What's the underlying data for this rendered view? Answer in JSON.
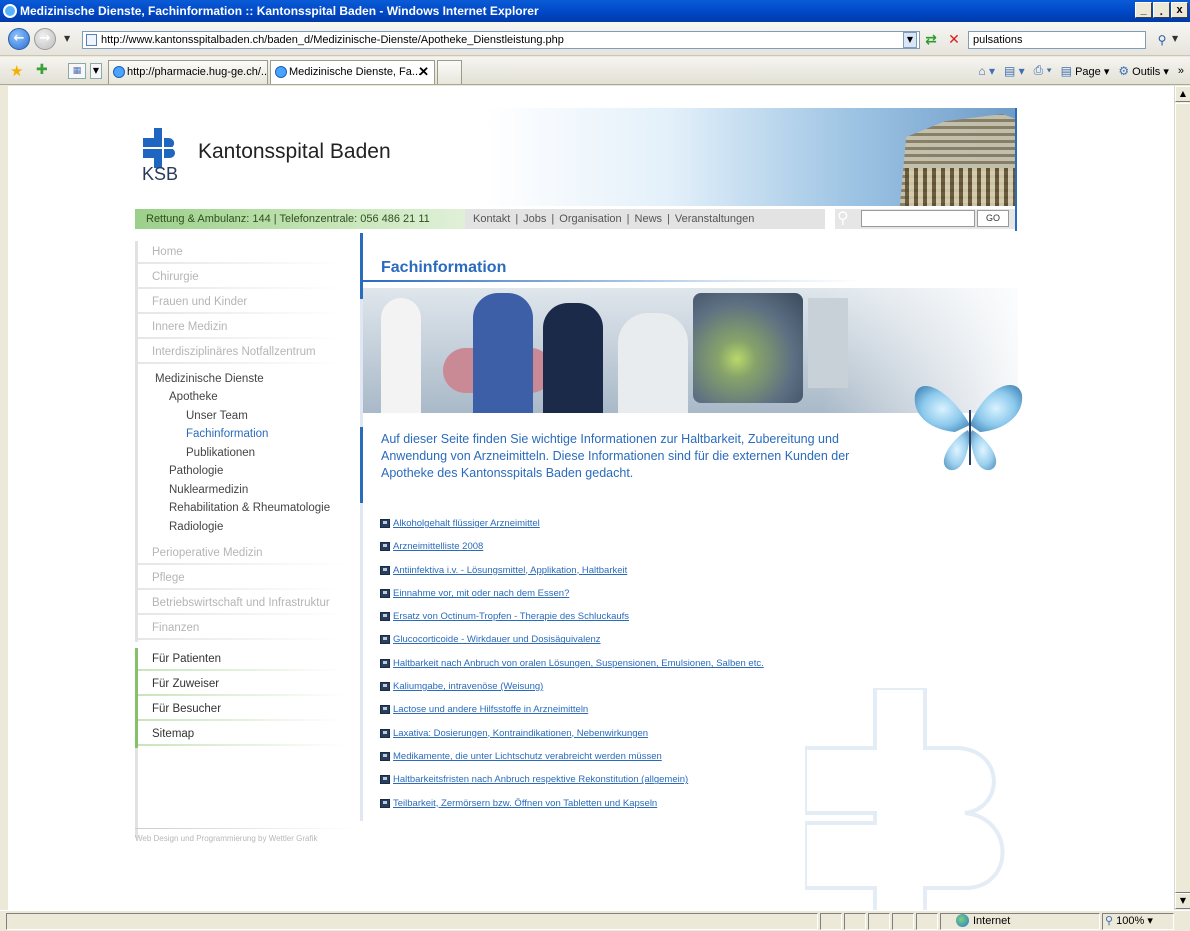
{
  "window": {
    "title": "Medizinische Dienste, Fachinformation :: Kantonsspital Baden - Windows Internet Explorer",
    "controls": [
      "_",
      "¸",
      "x"
    ]
  },
  "addressbar": {
    "url": "http://www.kantonsspitalbaden.ch/baden_d/Medizinische-Dienste/Apotheke_Dienstleistung.php",
    "search_value": "pulsations"
  },
  "tabs": [
    {
      "label": "http://pharmacie.hug-ge.ch/...",
      "active": false
    },
    {
      "label": "Medizinische Dienste, Fa...",
      "active": true
    }
  ],
  "commandbar": {
    "page_label": "Page",
    "tools_label": "Outils"
  },
  "status": {
    "zone": "Internet",
    "zoom": "100%"
  },
  "site": {
    "logo_text": "KSB",
    "brand": "Kantonsspital Baden",
    "emergency": "Rettung & Ambulanz: 144 | Telefonzentrale: 056 486 21 11",
    "topnav": [
      "Kontakt",
      "Jobs",
      "Organisation",
      "News",
      "Veranstaltungen"
    ],
    "search_button": "GO",
    "sidebar": {
      "top_items": [
        "Home",
        "Chirurgie",
        "Frauen und Kinder",
        "Innere Medizin",
        "Interdisziplinäres Notfallzentrum"
      ],
      "open_section": "Medizinische Dienste",
      "open_sub": "Apotheke",
      "sub_sub": [
        "Unser Team",
        "Fachinformation",
        "Publikationen"
      ],
      "open_rest": [
        "Pathologie",
        "Nuklearmedizin",
        "Rehabilitation & Rheumatologie",
        "Radiologie"
      ],
      "bottom_items": [
        "Perioperative Medizin",
        "Pflege",
        "Betriebswirtschaft und Infrastruktur",
        "Finanzen"
      ],
      "green_items": [
        "Für Patienten",
        "Für Zuweiser",
        "Für Besucher",
        "Sitemap"
      ]
    },
    "page_title": "Fachinformation",
    "intro": "Auf dieser Seite finden Sie wichtige Informationen zur Haltbarkeit, Zubereitung und Anwendung von Arzneimitteln. Diese Informationen sind für die externen Kunden der Apotheke des Kantonsspitals Baden gedacht.",
    "documents": [
      "Alkoholgehalt flüssiger Arzneimittel",
      "Arzneimittelliste 2008",
      "Antiinfektiva i.v. - Lösungsmittel, Applikation, Haltbarkeit",
      "Einnahme vor, mit oder nach dem Essen?",
      "Ersatz von Octinum-Tropfen - Therapie des Schluckaufs",
      "Glucocorticoide - Wirkdauer und Dosisäquivalenz",
      "Haltbarkeit nach Anbruch von oralen Lösungen, Suspensionen, Emulsionen, Salben etc.",
      "Kaliumgabe, intravenöse (Weisung)",
      "Lactose und andere Hilfsstoffe in Arzneimitteln",
      "Laxativa: Dosierungen, Kontraindikationen, Nebenwirkungen",
      "Medikamente, die unter Lichtschutz verabreicht werden müssen",
      "Haltbarkeitsfristen nach Anbruch respektive Rekonstitution (allgemein)",
      "Teilbarkeit, Zermörsern bzw. Öffnen von Tabletten und Kapseln"
    ],
    "footer": "Web Design und Programmierung by Wettler Grafik"
  },
  "colors": {
    "accent": "#2a6bbd",
    "green": "#86c16a",
    "titlebar": "#0a5bd6"
  }
}
